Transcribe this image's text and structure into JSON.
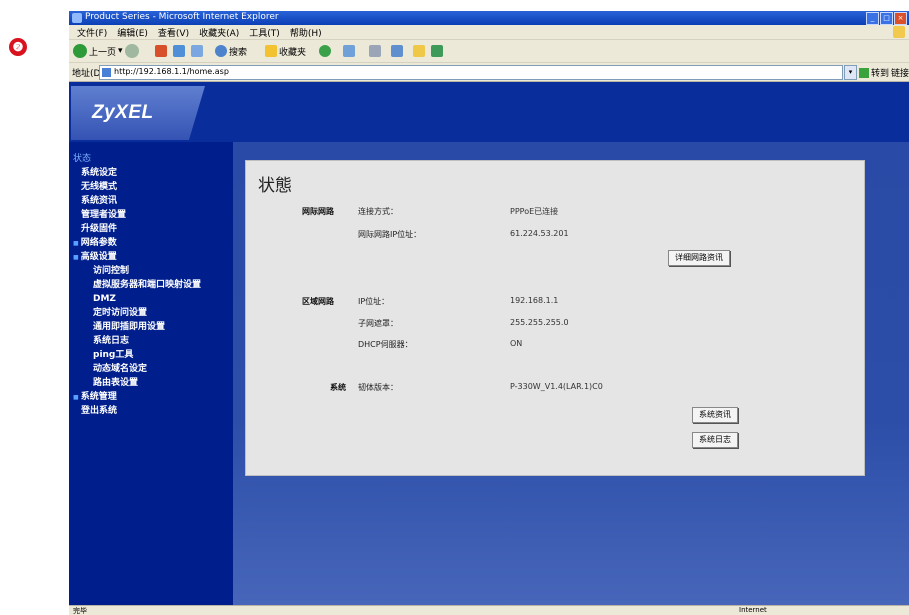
{
  "step_badge": "❷",
  "window": {
    "title": "Product Series - Microsoft Internet Explorer",
    "controls": [
      "_",
      "□",
      "×"
    ]
  },
  "menu": [
    "文件(F)",
    "编辑(E)",
    "查看(V)",
    "收藏夹(A)",
    "工具(T)",
    "帮助(H)"
  ],
  "toolbar": {
    "back_label": "上一页",
    "search_label": "搜索",
    "favorites_label": "收藏夹"
  },
  "address": {
    "label": "地址(D)",
    "url": "http://192.168.1.1/home.asp",
    "go_label": "转到",
    "links_label": "链接"
  },
  "brand": {
    "logo": "ZyXEL"
  },
  "sidebar": {
    "items": [
      {
        "label": "状态",
        "type": "active"
      },
      {
        "label": "系统设定",
        "type": "l1"
      },
      {
        "label": "无线模式",
        "type": "l1"
      },
      {
        "label": "系统资讯",
        "type": "l1"
      },
      {
        "label": "管理者设置",
        "type": "l1"
      },
      {
        "label": "升级固件",
        "type": "l1"
      },
      {
        "label": "网络参数",
        "type": "sect"
      },
      {
        "label": "高级设置",
        "type": "sect"
      },
      {
        "label": "访问控制",
        "type": "sub"
      },
      {
        "label": "虚拟服务器和端口映射设置",
        "type": "sub"
      },
      {
        "label": "DMZ",
        "type": "sub"
      },
      {
        "label": "定时访问设置",
        "type": "sub"
      },
      {
        "label": "通用即插即用设置",
        "type": "sub"
      },
      {
        "label": "系统日志",
        "type": "sub"
      },
      {
        "label": "ping工具",
        "type": "sub"
      },
      {
        "label": "动态域名设定",
        "type": "sub"
      },
      {
        "label": "路由表设置",
        "type": "sub"
      },
      {
        "label": "系统管理",
        "type": "sect"
      },
      {
        "label": "登出系统",
        "type": "l1"
      }
    ]
  },
  "main": {
    "title": "状態",
    "wan": {
      "section": "网际网路",
      "conn_type_label": "连接方式：",
      "conn_type_value": "PPPoE已连接",
      "ip_label": "网际网路IP位址：",
      "ip_value": "61.224.53.201",
      "button": "详细网路资讯"
    },
    "lan": {
      "section": "区域网路",
      "ip_label": "IP位址：",
      "ip_value": "192.168.1.1",
      "mask_label": "子网遮罩：",
      "mask_value": "255.255.255.0",
      "dhcp_label": "DHCP伺服器：",
      "dhcp_value": "ON"
    },
    "system": {
      "section": "系统",
      "fw_label": "韧体版本：",
      "fw_value": "P-330W_V1.4(LAR.1)C0",
      "button1": "系统资讯",
      "button2": "系统日志"
    }
  },
  "status_bar": {
    "left": "完毕",
    "right": "Internet"
  }
}
